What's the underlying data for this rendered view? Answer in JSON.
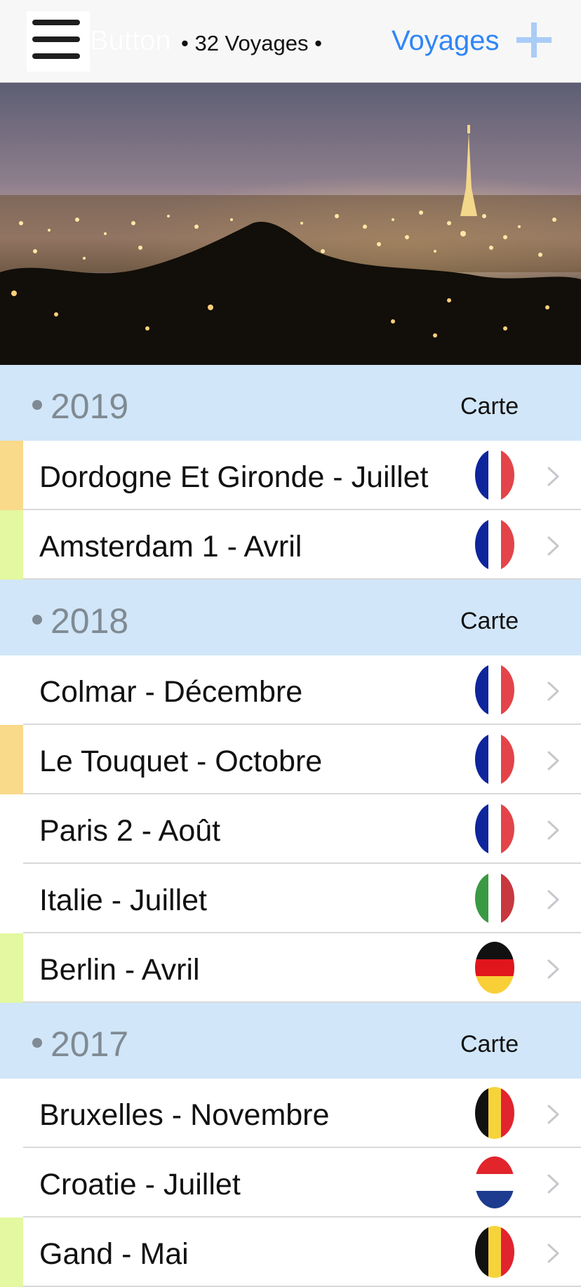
{
  "nav": {
    "ghost_button_label": "Button",
    "count_label": "• 32 Voyages •",
    "voyages_link": "Voyages",
    "icons": {
      "menu": "hamburger-icon",
      "add": "plus-icon"
    },
    "accent_color": "#2f86f6"
  },
  "hero": {
    "description_icon": "city-night-photo"
  },
  "sections": [
    {
      "year": "2019",
      "map_label": "Carte",
      "items": [
        {
          "title": "Dordogne Et Gironde - Juillet",
          "flag": "france",
          "marker": "#f9d98a"
        },
        {
          "title": "Amsterdam 1 - Avril",
          "flag": "france",
          "marker": "#e3f8a0"
        }
      ]
    },
    {
      "year": "2018",
      "map_label": "Carte",
      "items": [
        {
          "title": "Colmar - Décembre",
          "flag": "france",
          "marker": ""
        },
        {
          "title": "Le Touquet - Octobre",
          "flag": "france",
          "marker": "#f9d98a"
        },
        {
          "title": "Paris 2 - Août",
          "flag": "france",
          "marker": ""
        },
        {
          "title": "Italie - Juillet",
          "flag": "italy",
          "marker": ""
        },
        {
          "title": "Berlin - Avril",
          "flag": "germany",
          "marker": "#e3f8a0"
        }
      ]
    },
    {
      "year": "2017",
      "map_label": "Carte",
      "items": [
        {
          "title": "Bruxelles - Novembre",
          "flag": "belgium",
          "marker": ""
        },
        {
          "title": "Croatie - Juillet",
          "flag": "croatia",
          "marker": ""
        },
        {
          "title": "Gand - Mai",
          "flag": "belgium",
          "marker": "#e3f8a0"
        }
      ]
    }
  ],
  "colors": {
    "section_bg": "#d1e6f8",
    "yellow_marker": "#f9d98a",
    "green_marker": "#e3f8a0"
  }
}
